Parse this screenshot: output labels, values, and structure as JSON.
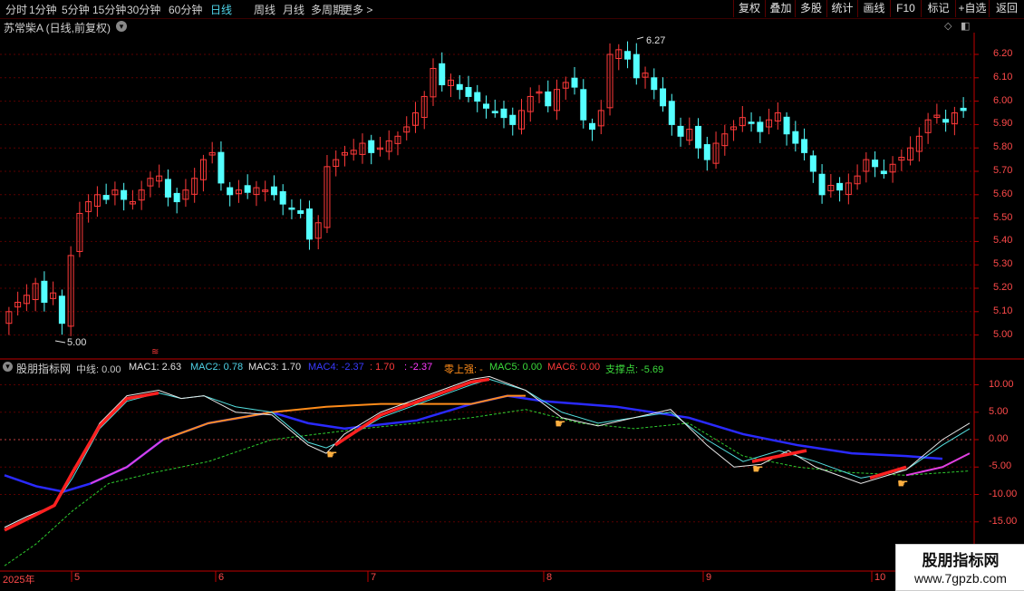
{
  "toolbar": {
    "tabs": [
      "分时",
      "1分钟",
      "5分钟",
      "15分钟",
      "30分钟",
      "60分钟",
      "日线",
      "周线",
      "月线",
      "多周期",
      "更多 >"
    ],
    "active": "日线",
    "right_buttons": [
      "复权",
      "叠加",
      "多股",
      "统计",
      "画线",
      "F10",
      "标记",
      "+自选",
      "返回"
    ]
  },
  "stock": {
    "title": "苏常柴A (日线,前复权)",
    "high_label": "6.27",
    "low_label": "5.00"
  },
  "price_axis": [
    "6.20",
    "6.10",
    "6.00",
    "5.90",
    "5.80",
    "5.70",
    "5.60",
    "5.50",
    "5.40",
    "5.30",
    "5.20",
    "5.10",
    "5.00"
  ],
  "indicator": {
    "name": "股朋指标网",
    "legend": [
      {
        "text": "中线: 0.00",
        "color": "#c8c8c8"
      },
      {
        "text": "MAC1: 2.63",
        "color": "#e0e0e0"
      },
      {
        "text": "MAC2: 0.78",
        "color": "#4fd3e8"
      },
      {
        "text": "MAC3: 1.70",
        "color": "#e0e0e0"
      },
      {
        "text": "MAC4: -2.37",
        "color": "#3a3aff"
      },
      {
        "text": ": 1.70",
        "color": "#ff3a3a"
      },
      {
        "text": ": -2.37",
        "color": "#ff3aff"
      },
      {
        "text": "零上强: -",
        "color": "#ff8c1a"
      },
      {
        "text": "MAC5: 0.00",
        "color": "#3cdc3c"
      },
      {
        "text": "MAC6: 0.00",
        "color": "#ff3a3a"
      },
      {
        "text": "支撑点: -5.69",
        "color": "#3cdc3c"
      }
    ],
    "axis": [
      "10.00",
      "5.00",
      "0.00",
      "-5.00",
      "-10.00",
      "-15.00"
    ]
  },
  "time_axis": [
    "2025年",
    "5",
    "6",
    "7",
    "8",
    "9",
    "10"
  ],
  "watermark": {
    "line1": "股朋指标网",
    "line2": "www.7gpzb.com"
  },
  "colors": {
    "up": "#ff3a3a",
    "down": "#54ffff",
    "axis": "#c00000"
  }
}
